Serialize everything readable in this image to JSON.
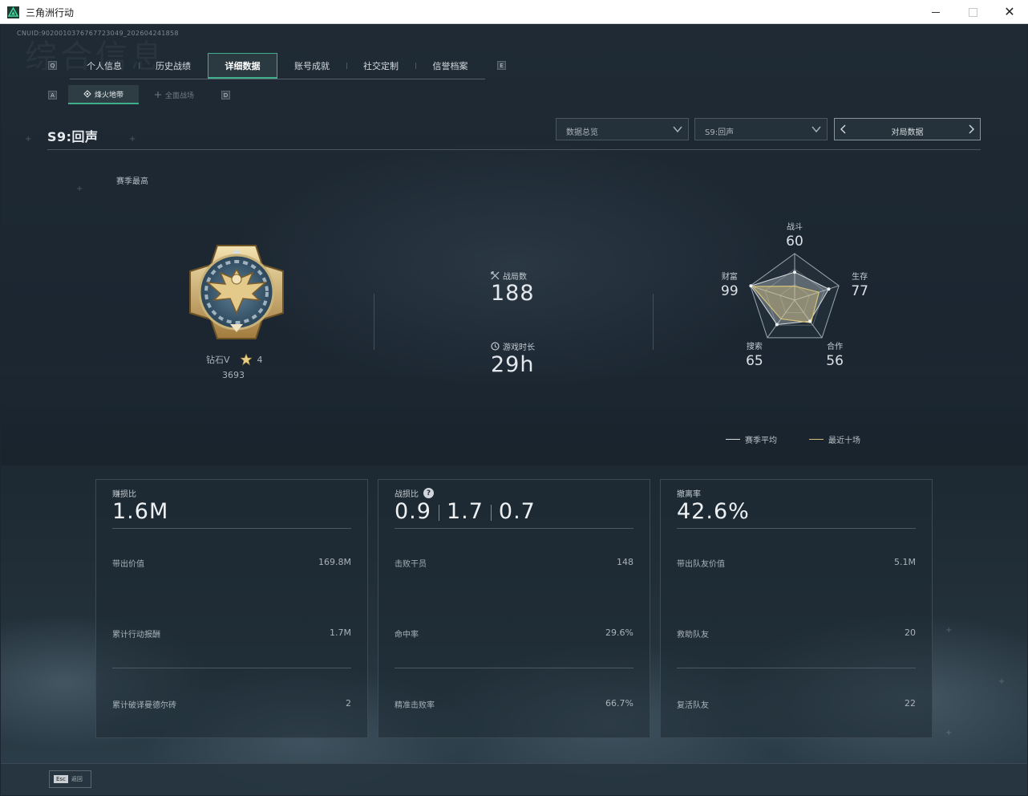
{
  "window": {
    "title": "三角洲行动"
  },
  "header": {
    "cnuid": "CNUID:9020010376767723049_202604241858",
    "watermark": "综合信息"
  },
  "tabs": {
    "left_key": "Q",
    "right_key": "E",
    "items": [
      {
        "label": "个人信息"
      },
      {
        "label": "历史战绩"
      },
      {
        "label": "详细数据"
      },
      {
        "label": "账号成就"
      },
      {
        "label": "社交定制"
      },
      {
        "label": "信誉档案"
      }
    ]
  },
  "subtabs": {
    "left_key": "A",
    "right_key": "D",
    "items": [
      {
        "label": "烽火地带"
      },
      {
        "label": "全面战场"
      }
    ]
  },
  "season": {
    "title": "S9:回声"
  },
  "filters": {
    "mode": "数据总览",
    "season": "S9:回声",
    "pager": "对局数据"
  },
  "best": {
    "label": "赛季最高",
    "rank": "钻石V",
    "stars": "4",
    "score": "3693"
  },
  "summary": {
    "matches_label": "战局数",
    "matches_value": "188",
    "playtime_label": "游戏时长",
    "playtime_value": "29h"
  },
  "radar": {
    "axes": [
      {
        "label": "战斗",
        "value": "60"
      },
      {
        "label": "生存",
        "value": "77"
      },
      {
        "label": "合作",
        "value": "56"
      },
      {
        "label": "搜索",
        "value": "65"
      },
      {
        "label": "财富",
        "value": "99"
      }
    ],
    "season_avg": [
      0.6,
      0.77,
      0.56,
      0.65,
      0.99
    ],
    "recent_ten": [
      0.3,
      0.55,
      0.6,
      0.5,
      0.95
    ],
    "legend_avg": "赛季平均",
    "legend_recent": "最近十场",
    "color_avg": "#d9dde0",
    "color_recent": "#d6c27a"
  },
  "cards": [
    {
      "title": "赚损比",
      "big": "1.6M",
      "rows": [
        {
          "label": "带出价值",
          "value": "169.8M"
        },
        {
          "label": "累计行动报酬",
          "value": "1.7M"
        },
        {
          "label": "累计破译曼德尔砖",
          "value": "2"
        }
      ]
    },
    {
      "title": "战损比",
      "help": "?",
      "big_parts": [
        "0.9",
        "1.7",
        "0.7"
      ],
      "rows": [
        {
          "label": "击败干员",
          "value": "148"
        },
        {
          "label": "命中率",
          "value": "29.6%"
        },
        {
          "label": "精准击败率",
          "value": "66.7%"
        }
      ]
    },
    {
      "title": "撤离率",
      "big": "42.6%",
      "rows": [
        {
          "label": "带出队友价值",
          "value": "5.1M"
        },
        {
          "label": "救助队友",
          "value": "20"
        },
        {
          "label": "复活队友",
          "value": "22"
        }
      ]
    }
  ],
  "footer": {
    "esc_key": "Esc",
    "esc_label": "返回"
  }
}
